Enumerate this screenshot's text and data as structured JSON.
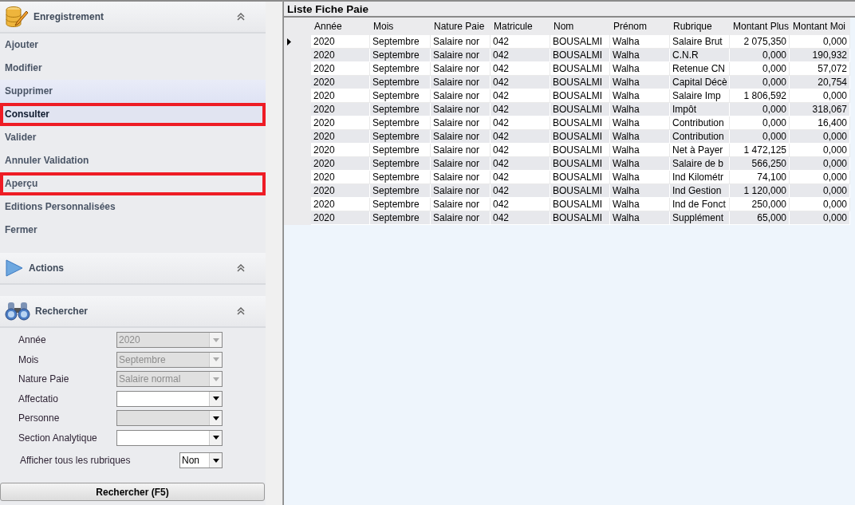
{
  "sidebar": {
    "sections": [
      {
        "kind": "menu",
        "title": "Enregistrement",
        "items": [
          {
            "label": "Ajouter",
            "selected": false,
            "hovered": false,
            "outlined": false
          },
          {
            "label": "Modifier",
            "selected": false,
            "hovered": false,
            "outlined": false
          },
          {
            "label": "Supprimer",
            "selected": false,
            "hovered": true,
            "outlined": false
          },
          {
            "label": "Consulter",
            "selected": true,
            "hovered": false,
            "outlined": true
          },
          {
            "label": "Valider",
            "selected": false,
            "hovered": false,
            "outlined": false
          },
          {
            "label": "Annuler Validation",
            "selected": false,
            "hovered": false,
            "outlined": false
          },
          {
            "label": "Aperçu",
            "selected": false,
            "hovered": false,
            "outlined": true
          },
          {
            "label": "Editions Personnalisées",
            "selected": false,
            "hovered": false,
            "outlined": false
          },
          {
            "label": "Fermer",
            "selected": false,
            "hovered": false,
            "outlined": false
          }
        ]
      },
      {
        "kind": "actions",
        "title": "Actions"
      },
      {
        "kind": "search",
        "title": "Rechercher",
        "fields": [
          {
            "label": "Année",
            "value": "2020",
            "disabled": true,
            "readonly": true
          },
          {
            "label": "Mois",
            "value": "Septembre",
            "disabled": true,
            "readonly": true
          },
          {
            "label": "Nature Paie",
            "value": "Salaire normal",
            "disabled": true,
            "readonly": true
          },
          {
            "label": "Affectatio",
            "disabled": false,
            "readonly": false
          },
          {
            "label": "Personne",
            "disabled": false,
            "readonly": true
          },
          {
            "label": "Section Analytique",
            "disabled": false,
            "readonly": false
          }
        ],
        "option": {
          "label": "Afficher tous les rubriques",
          "value": "Non"
        },
        "button": "Rechercher (F5)"
      }
    ]
  },
  "list": {
    "title": "Liste Fiche Paie",
    "columns": [
      "Année",
      "Mois",
      "Nature Paie",
      "Matricule",
      "Nom",
      "Prénom",
      "Rubrique",
      "Montant Plus",
      "Montant Moi"
    ],
    "rows": [
      {
        "current": true,
        "cells": [
          "2020",
          "Septembre",
          "Salaire nor",
          "042",
          "BOUSALMI",
          "Walha",
          "Salaire Brut",
          "2 075,350",
          "0,000"
        ]
      },
      {
        "current": false,
        "cells": [
          "2020",
          "Septembre",
          "Salaire nor",
          "042",
          "BOUSALMI",
          "Walha",
          "C.N.R",
          "0,000",
          "190,932"
        ]
      },
      {
        "current": false,
        "cells": [
          "2020",
          "Septembre",
          "Salaire nor",
          "042",
          "BOUSALMI",
          "Walha",
          "Retenue CN",
          "0,000",
          "57,072"
        ]
      },
      {
        "current": false,
        "cells": [
          "2020",
          "Septembre",
          "Salaire nor",
          "042",
          "BOUSALMI",
          "Walha",
          "Capital Décè",
          "0,000",
          "20,754"
        ]
      },
      {
        "current": false,
        "cells": [
          "2020",
          "Septembre",
          "Salaire nor",
          "042",
          "BOUSALMI",
          "Walha",
          "Salaire Imp",
          "1 806,592",
          "0,000"
        ]
      },
      {
        "current": false,
        "cells": [
          "2020",
          "Septembre",
          "Salaire nor",
          "042",
          "BOUSALMI",
          "Walha",
          "Impôt",
          "0,000",
          "318,067"
        ]
      },
      {
        "current": false,
        "cells": [
          "2020",
          "Septembre",
          "Salaire nor",
          "042",
          "BOUSALMI",
          "Walha",
          "Contribution",
          "0,000",
          "16,400"
        ]
      },
      {
        "current": false,
        "cells": [
          "2020",
          "Septembre",
          "Salaire nor",
          "042",
          "BOUSALMI",
          "Walha",
          "Contribution",
          "0,000",
          "0,000"
        ]
      },
      {
        "current": false,
        "cells": [
          "2020",
          "Septembre",
          "Salaire nor",
          "042",
          "BOUSALMI",
          "Walha",
          "Net à Payer",
          "1 472,125",
          "0,000"
        ]
      },
      {
        "current": false,
        "cells": [
          "2020",
          "Septembre",
          "Salaire nor",
          "042",
          "BOUSALMI",
          "Walha",
          "Salaire de b",
          "566,250",
          "0,000"
        ]
      },
      {
        "current": false,
        "cells": [
          "2020",
          "Septembre",
          "Salaire nor",
          "042",
          "BOUSALMI",
          "Walha",
          "Ind Kilométr",
          "74,100",
          "0,000"
        ]
      },
      {
        "current": false,
        "cells": [
          "2020",
          "Septembre",
          "Salaire nor",
          "042",
          "BOUSALMI",
          "Walha",
          "Ind Gestion",
          "1 120,000",
          "0,000"
        ]
      },
      {
        "current": false,
        "cells": [
          "2020",
          "Septembre",
          "Salaire nor",
          "042",
          "BOUSALMI",
          "Walha",
          "Ind de Fonct",
          "250,000",
          "0,000"
        ]
      },
      {
        "current": false,
        "cells": [
          "2020",
          "Septembre",
          "Salaire nor",
          "042",
          "BOUSALMI",
          "Walha",
          "Supplément",
          "65,000",
          "0,000"
        ]
      }
    ]
  }
}
